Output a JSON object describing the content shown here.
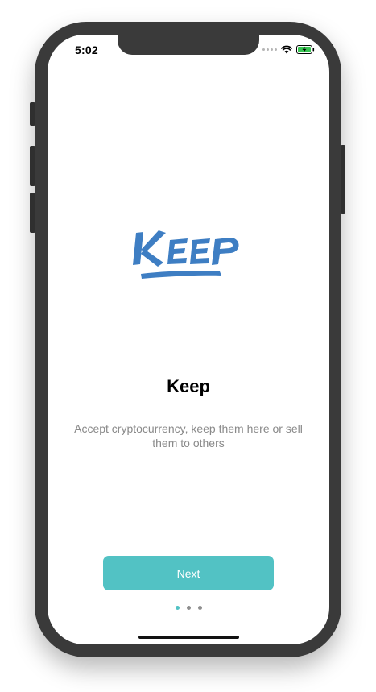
{
  "status_bar": {
    "time": "5:02"
  },
  "brand": {
    "logo_text": "Keep",
    "logo_color": "#3e7ec3"
  },
  "onboarding": {
    "title": "Keep",
    "description": "Accept cryptocurrency, keep them here or sell them to others",
    "next_label": "Next",
    "accent_color": "#52c2c4",
    "pager": {
      "total_pages": 3,
      "current_page": 1
    }
  },
  "icons": [
    "signal-icon",
    "wifi-icon",
    "battery-charging-icon"
  ]
}
